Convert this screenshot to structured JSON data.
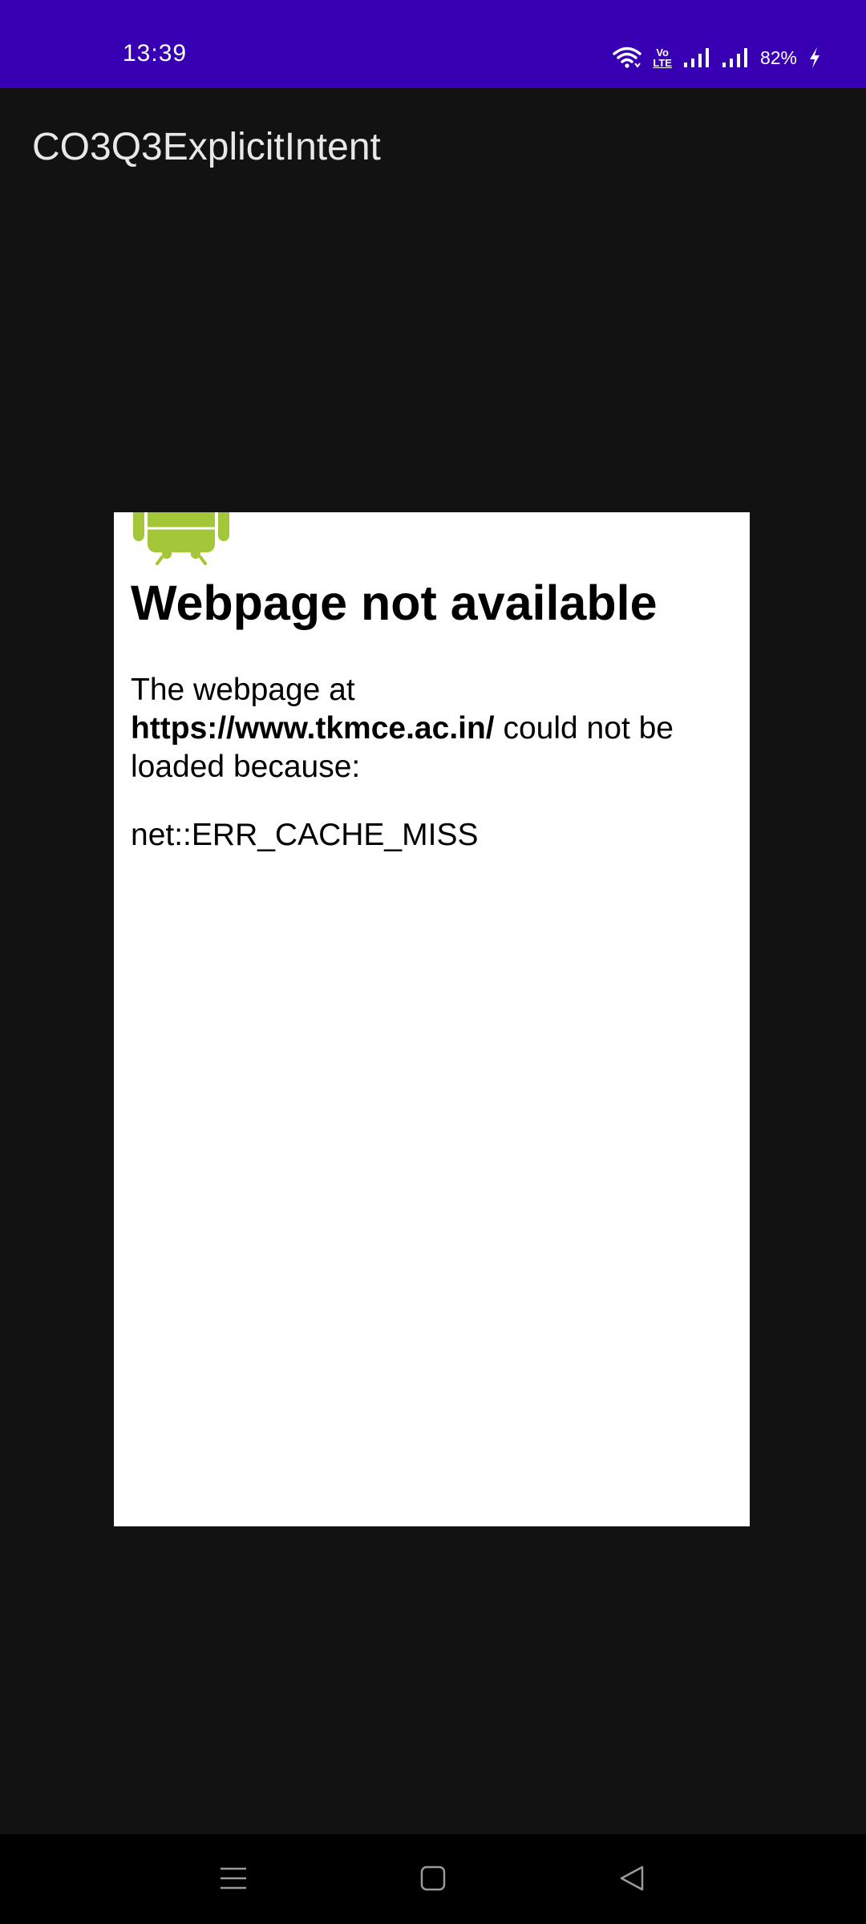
{
  "status_bar": {
    "time": "13:39",
    "battery_percent": "82%",
    "background_color": "#3700b3",
    "icons": [
      "wifi-icon",
      "volte-icon",
      "signal-1-icon",
      "signal-2-icon",
      "charging-icon"
    ],
    "volte_label_top": "Vo",
    "volte_label_bottom": "LTE"
  },
  "app_bar": {
    "title": "CO3Q3ExplicitIntent"
  },
  "webview": {
    "logo_icon": "android-robot-icon",
    "logo_color": "#a4c639",
    "heading": "Webpage not available",
    "body_prefix": "The webpage at ",
    "url": "https://www.tkmce.ac.in/",
    "body_suffix": " could not be loaded because:",
    "error_code": "net::ERR_CACHE_MISS"
  },
  "nav_bar": {
    "buttons": [
      "menu-icon",
      "home-icon",
      "back-icon"
    ]
  }
}
